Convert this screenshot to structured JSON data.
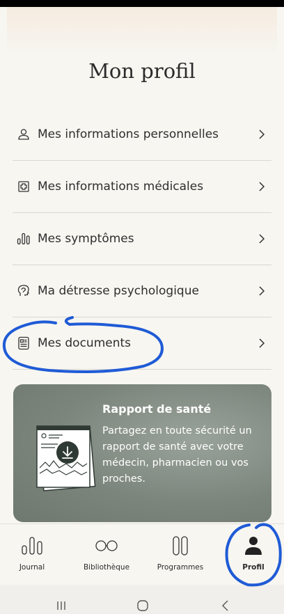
{
  "header": {
    "title": "Mon profil"
  },
  "menu": {
    "items": [
      {
        "label": "Mes informations personnelles",
        "icon": "person-icon"
      },
      {
        "label": "Mes informations médicales",
        "icon": "medical-cross-icon"
      },
      {
        "label": "Mes symptômes",
        "icon": "bars-icon"
      },
      {
        "label": "Ma détresse psychologique",
        "icon": "head-icon"
      },
      {
        "label": "Mes documents",
        "icon": "document-icon"
      }
    ]
  },
  "card": {
    "title": "Rapport de santé",
    "text": "Partagez en toute sécurité un rapport de santé avec votre médecin, pharmacien ou vos proches."
  },
  "nav": {
    "items": [
      {
        "label": "Journal",
        "icon": "journal-icon"
      },
      {
        "label": "Bibliothèque",
        "icon": "glasses-icon"
      },
      {
        "label": "Programmes",
        "icon": "programs-icon"
      },
      {
        "label": "Profil",
        "icon": "profile-icon",
        "active": true
      }
    ]
  },
  "colors": {
    "background": "#f7f6f1",
    "card": "#7c857c",
    "annotation": "#1f5bd6",
    "text": "#2b2b2b"
  }
}
